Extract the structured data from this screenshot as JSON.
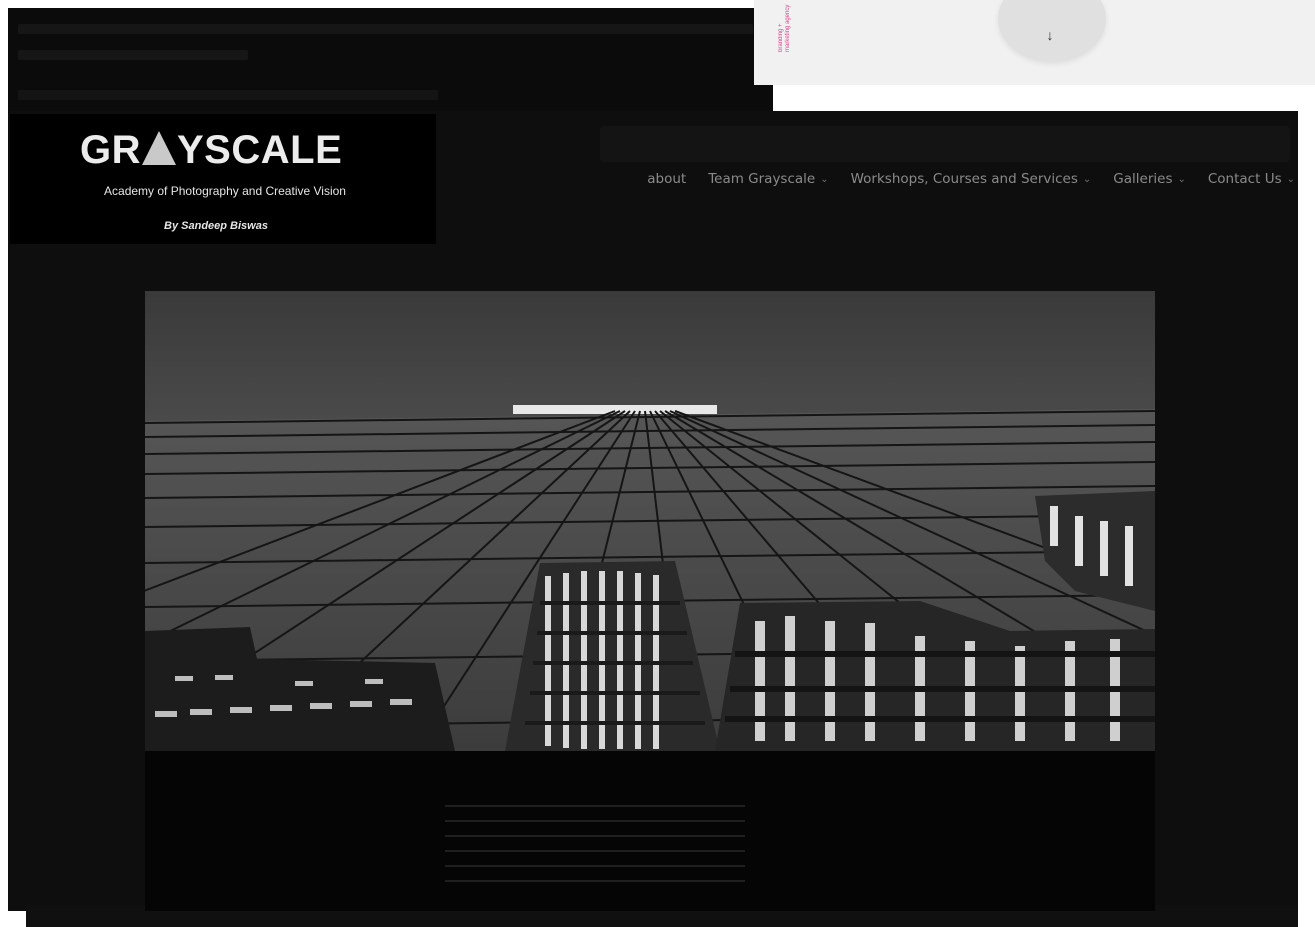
{
  "window": {
    "agency_tag": "branding + marketing agency"
  },
  "scroll_button": {
    "icon": "arrow-down-icon",
    "glyph": "↓"
  },
  "brand": {
    "name_pre": "GR",
    "name_post": "YSCALE",
    "tagline": "Academy of Photography and Creative Vision",
    "byline": "By Sandeep Biswas"
  },
  "nav": {
    "items": [
      {
        "label": "about",
        "has_dropdown": false
      },
      {
        "label": "Team Grayscale",
        "has_dropdown": true
      },
      {
        "label": "Workshops, Courses and Services",
        "has_dropdown": true
      },
      {
        "label": "Galleries",
        "has_dropdown": true
      },
      {
        "label": "Contact Us",
        "has_dropdown": true
      }
    ],
    "dropdown_glyph": "⌄"
  },
  "hero": {
    "subject": "black and white upward view of a glass skyscraper reflecting older buildings"
  },
  "colors": {
    "background": "#0e0e0e",
    "nav_text": "#8a8a8a",
    "logo_text": "#ececec",
    "agency_accent": "#d84a8c",
    "panel": "#f1f1f1"
  }
}
